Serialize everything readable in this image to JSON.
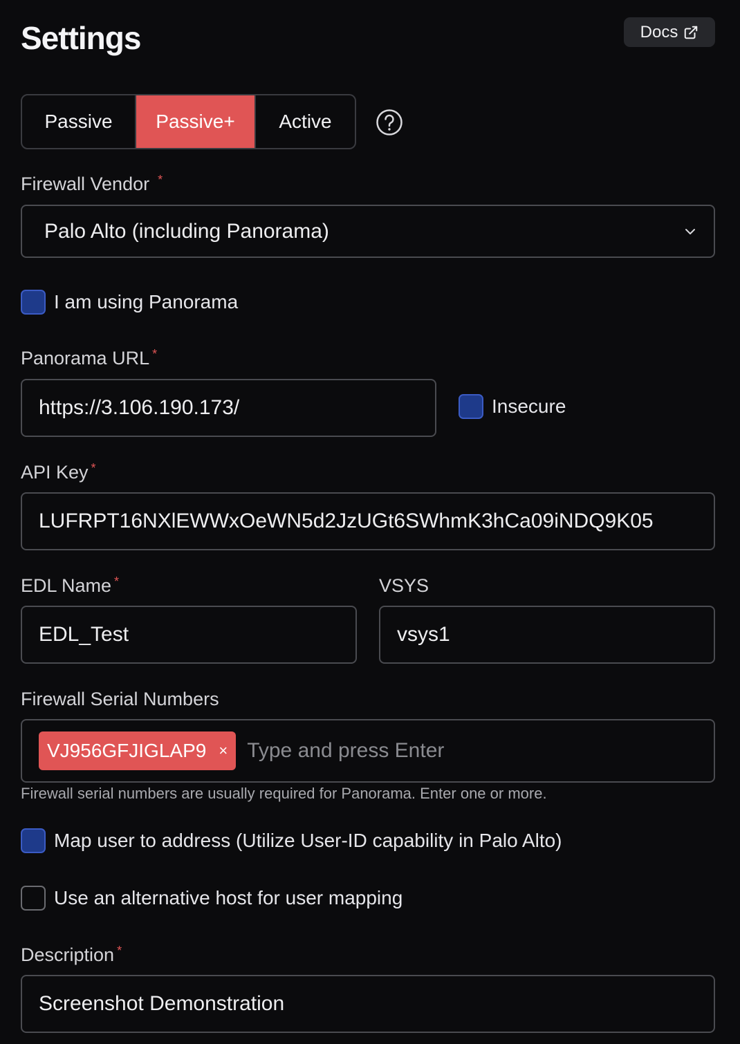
{
  "page": {
    "title": "Settings"
  },
  "docs": {
    "label": "Docs",
    "icon": "external-link-icon"
  },
  "modes": [
    {
      "label": "Passive",
      "selected": false
    },
    {
      "label": "Passive+",
      "selected": true
    },
    {
      "label": "Active",
      "selected": false
    }
  ],
  "help": {
    "icon": "question-circle-icon"
  },
  "firewall_vendor": {
    "label": "Firewall Vendor",
    "required_mark": "*",
    "value": "Palo Alto (including Panorama)",
    "icon": "chevron-down-icon"
  },
  "use_panorama": {
    "label": "I am using Panorama",
    "checked": true
  },
  "panorama_url": {
    "label": "Panorama URL",
    "required_mark": "*",
    "value": "https://3.106.190.173/"
  },
  "insecure": {
    "label": "Insecure",
    "checked": true
  },
  "api_key": {
    "label": "API Key",
    "required_mark": "*",
    "value": "LUFRPT16NXlEWWxOeWN5d2JzUGt6SWhmK3hCa09iNDQ9K05"
  },
  "edl_name": {
    "label": "EDL Name",
    "required_mark": "*",
    "value": "EDL_Test"
  },
  "vsys": {
    "label": "VSYS",
    "value": "vsys1"
  },
  "serial_numbers": {
    "label": "Firewall Serial Numbers",
    "tags": [
      "VJ956GFJIGLAP9"
    ],
    "remove_glyph": "×",
    "placeholder": "Type and press Enter",
    "hint": "Firewall serial numbers are usually required for Panorama. Enter one or more."
  },
  "map_user": {
    "label": "Map user to address (Utilize User-ID capability in Palo Alto)",
    "checked": true
  },
  "alt_host": {
    "label": "Use an alternative host for user mapping",
    "checked": false
  },
  "description": {
    "label": "Description",
    "required_mark": "*",
    "value": "Screenshot Demonstration"
  },
  "colors": {
    "accent": "#e05555",
    "checkbox": "#1e3a8a",
    "background": "#0b0b0d"
  }
}
